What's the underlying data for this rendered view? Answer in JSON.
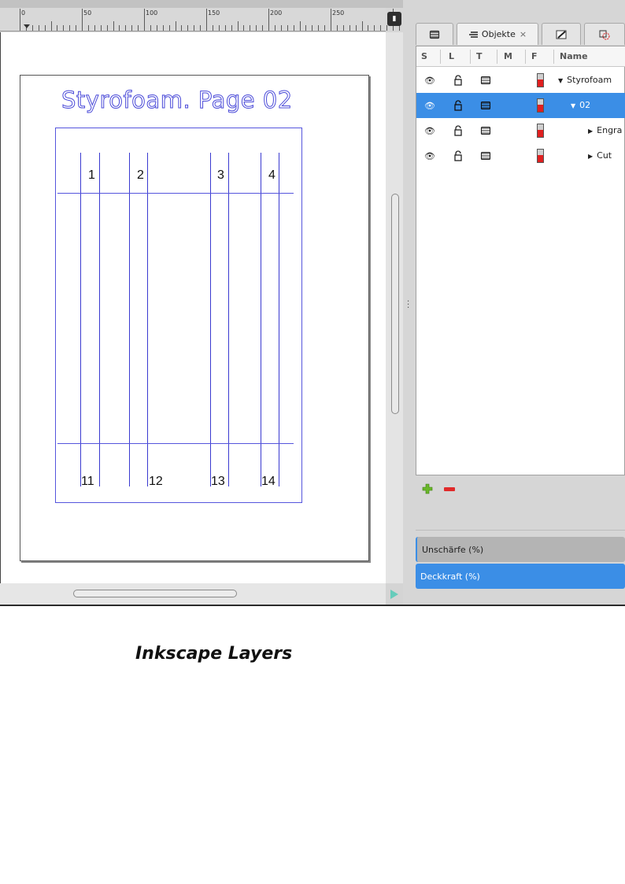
{
  "ruler": {
    "labels": [
      "0",
      "50",
      "100",
      "150",
      "200",
      "250"
    ]
  },
  "canvas": {
    "page_title": "Styrofoam. Page 02",
    "top_numbers": [
      "1",
      "2",
      "3",
      "4"
    ],
    "bottom_numbers": [
      "11",
      "12",
      "13",
      "14"
    ]
  },
  "panel": {
    "tabs": {
      "objects_label": "Objekte",
      "close": "×"
    },
    "columns": [
      "S",
      "L",
      "T",
      "M",
      "F",
      "Name"
    ],
    "rows": [
      {
        "name": "Styrofoam",
        "expanded": true,
        "selected": false
      },
      {
        "name": "02",
        "expanded": true,
        "selected": true
      },
      {
        "name": "Engra",
        "expanded": false,
        "selected": false
      },
      {
        "name": "Cut",
        "expanded": false,
        "selected": false
      }
    ],
    "blur_label": "Unschärfe (%)",
    "opacity_label": "Deckkraft (%)",
    "accent_color": "#3b8ee6"
  },
  "caption": "Inkscape Layers"
}
